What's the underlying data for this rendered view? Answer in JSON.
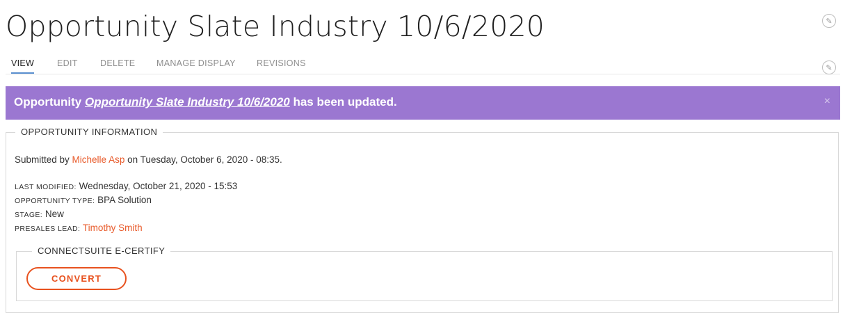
{
  "page_title": "Opportunity Slate Industry 10/6/2020",
  "tabs": [
    {
      "label": "VIEW"
    },
    {
      "label": "EDIT"
    },
    {
      "label": "DELETE"
    },
    {
      "label": "MANAGE DISPLAY"
    },
    {
      "label": "REVISIONS"
    }
  ],
  "active_tab": "VIEW",
  "status_message": {
    "prefix": "Opportunity ",
    "link_text": "Opportunity Slate Industry 10/6/2020",
    "suffix": " has been updated.",
    "close_glyph": "×"
  },
  "opportunity_info": {
    "legend": "OPPORTUNITY INFORMATION",
    "submitted_prefix": "Submitted by ",
    "submitted_by": "Michelle Asp",
    "submitted_suffix": " on Tuesday, October 6, 2020 - 08:35.",
    "last_modified_label": "LAST MODIFIED:",
    "last_modified_value": "Wednesday, October 21, 2020 - 15:53",
    "opportunity_type_label": "OPPORTUNITY TYPE:",
    "opportunity_type_value": "BPA Solution",
    "stage_label": "STAGE:",
    "stage_value": "New",
    "presales_lead_label": "PRESALES LEAD:",
    "presales_lead_value": "Timothy Smith"
  },
  "ecertify": {
    "legend": "CONNECTSUITE E-CERTIFY",
    "convert_label": "CONVERT"
  },
  "icons": {
    "edit_title": "pencil-icon",
    "edit_tabs": "pencil-icon",
    "close": "close-icon"
  },
  "colors": {
    "status_bg": "#9b77d1",
    "link": "#e85a2a",
    "convert_border": "#e8521f",
    "active_tab_underline": "#5a8fd0"
  }
}
